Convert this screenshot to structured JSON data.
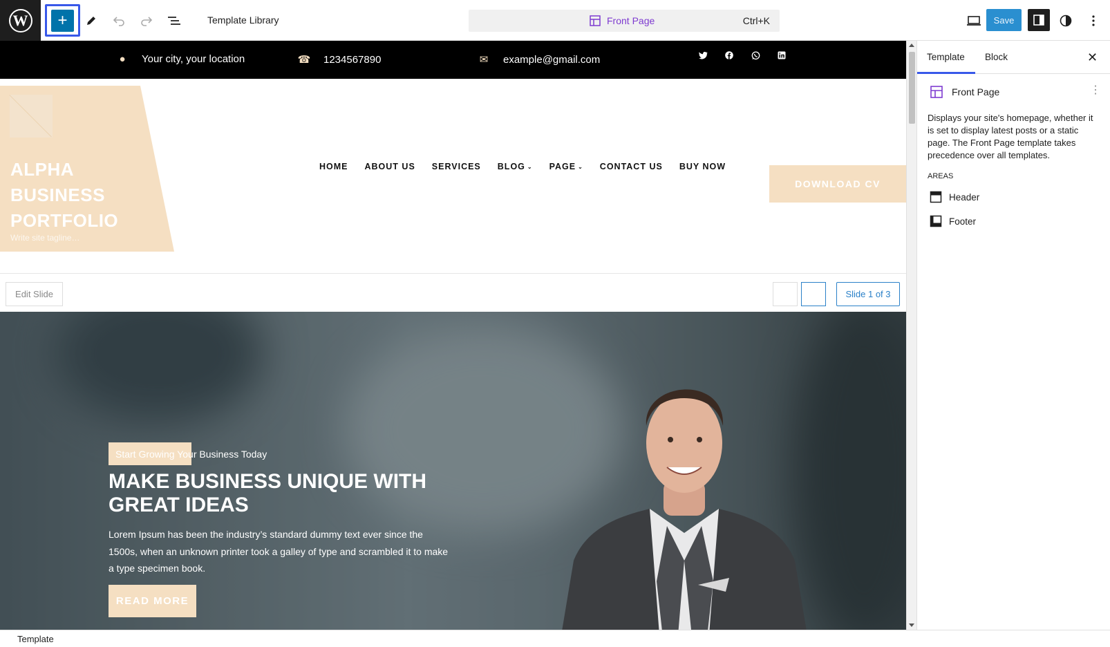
{
  "topbar": {
    "logo_text": "W",
    "inserter_label": "+",
    "title": "Template Library",
    "command": {
      "label": "Front Page",
      "shortcut": "Ctrl+K"
    },
    "save_label": "Save",
    "icons": [
      "pencil-icon",
      "undo-icon",
      "redo-icon",
      "list-view-icon",
      "desktop-preview-icon",
      "sidebar-settings-icon",
      "styles-contrast-icon",
      "more-options-icon"
    ]
  },
  "infobar": {
    "location": "Your city, your location",
    "phone": "1234567890",
    "email": "example@gmail.com",
    "socials": [
      "twitter",
      "facebook",
      "whatsapp",
      "linkedin"
    ]
  },
  "header": {
    "site_title": "ALPHA BUSINESS PORTFOLIO",
    "tagline": "Write site tagline…",
    "nav": [
      {
        "label": "HOME",
        "dropdown": false
      },
      {
        "label": "ABOUT US",
        "dropdown": false
      },
      {
        "label": "SERVICES",
        "dropdown": false
      },
      {
        "label": "BLOG",
        "dropdown": true
      },
      {
        "label": "PAGE",
        "dropdown": true
      },
      {
        "label": "CONTACT US",
        "dropdown": false
      },
      {
        "label": "BUY NOW",
        "dropdown": false
      }
    ],
    "cta": "DOWNLOAD CV"
  },
  "slider": {
    "edit_label": "Edit Slide",
    "counter": "Slide 1 of 3"
  },
  "hero": {
    "tag": "Start Growing Your Business Today",
    "title": "MAKE BUSINESS UNIQUE WITH GREAT IDEAS",
    "description": "Lorem Ipsum has been the industry’s standard dummy text ever since the 1500s, when an unknown printer took a galley of type and scrambled it to make a type specimen book.",
    "button": "READ MORE"
  },
  "sidebar": {
    "tabs": [
      "Template",
      "Block"
    ],
    "active_tab": "Template",
    "template_name": "Front Page",
    "description": "Displays your site's homepage, whether it is set to display latest posts or a static page. The Front Page template takes precedence over all templates.",
    "areas_heading": "AREAS",
    "areas": [
      "Header",
      "Footer"
    ]
  },
  "footer": {
    "breadcrumb": "Template"
  },
  "colors": {
    "accent": "#f5dfc2",
    "wp_blue": "#3858e9",
    "save_blue": "#2a8fd0",
    "template_purple": "#7e3bd0"
  }
}
